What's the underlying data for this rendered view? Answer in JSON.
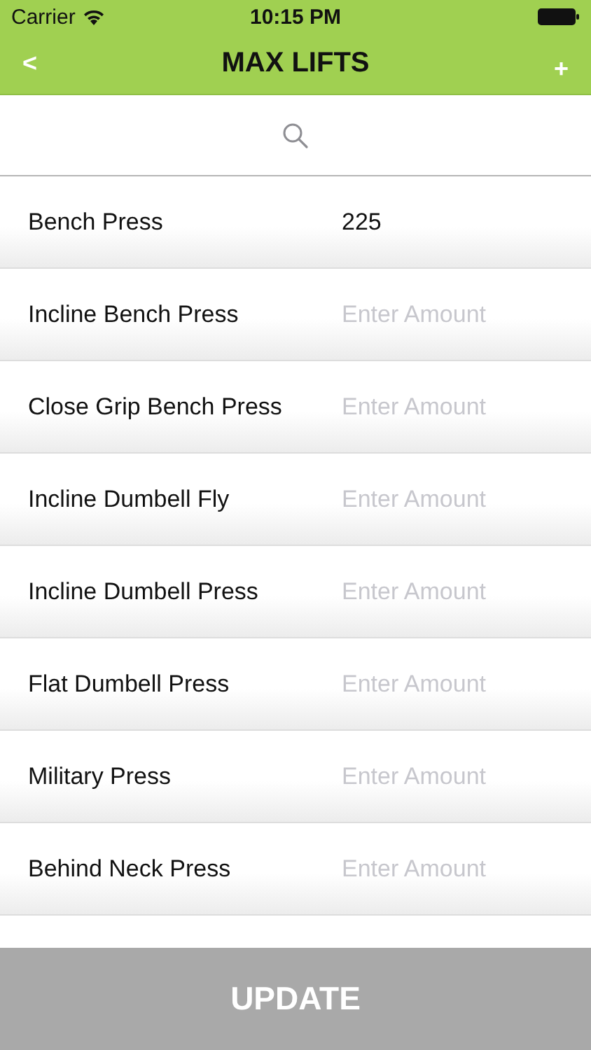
{
  "status_bar": {
    "carrier": "Carrier",
    "time": "10:15 PM"
  },
  "nav": {
    "back": "<",
    "title": "MAX LIFTS",
    "add": "+"
  },
  "lifts": [
    {
      "name": "Bench Press",
      "value": "225"
    },
    {
      "name": "Incline Bench Press",
      "placeholder": "Enter Amount"
    },
    {
      "name": "Close Grip Bench Press",
      "placeholder": "Enter Amount"
    },
    {
      "name": "Incline Dumbell Fly",
      "placeholder": "Enter Amount"
    },
    {
      "name": "Incline Dumbell Press",
      "placeholder": "Enter Amount"
    },
    {
      "name": "Flat Dumbell Press",
      "placeholder": "Enter Amount"
    },
    {
      "name": "Military Press",
      "placeholder": "Enter Amount"
    },
    {
      "name": "Behind Neck Press",
      "placeholder": "Enter Amount"
    }
  ],
  "update_button": "UPDATE"
}
